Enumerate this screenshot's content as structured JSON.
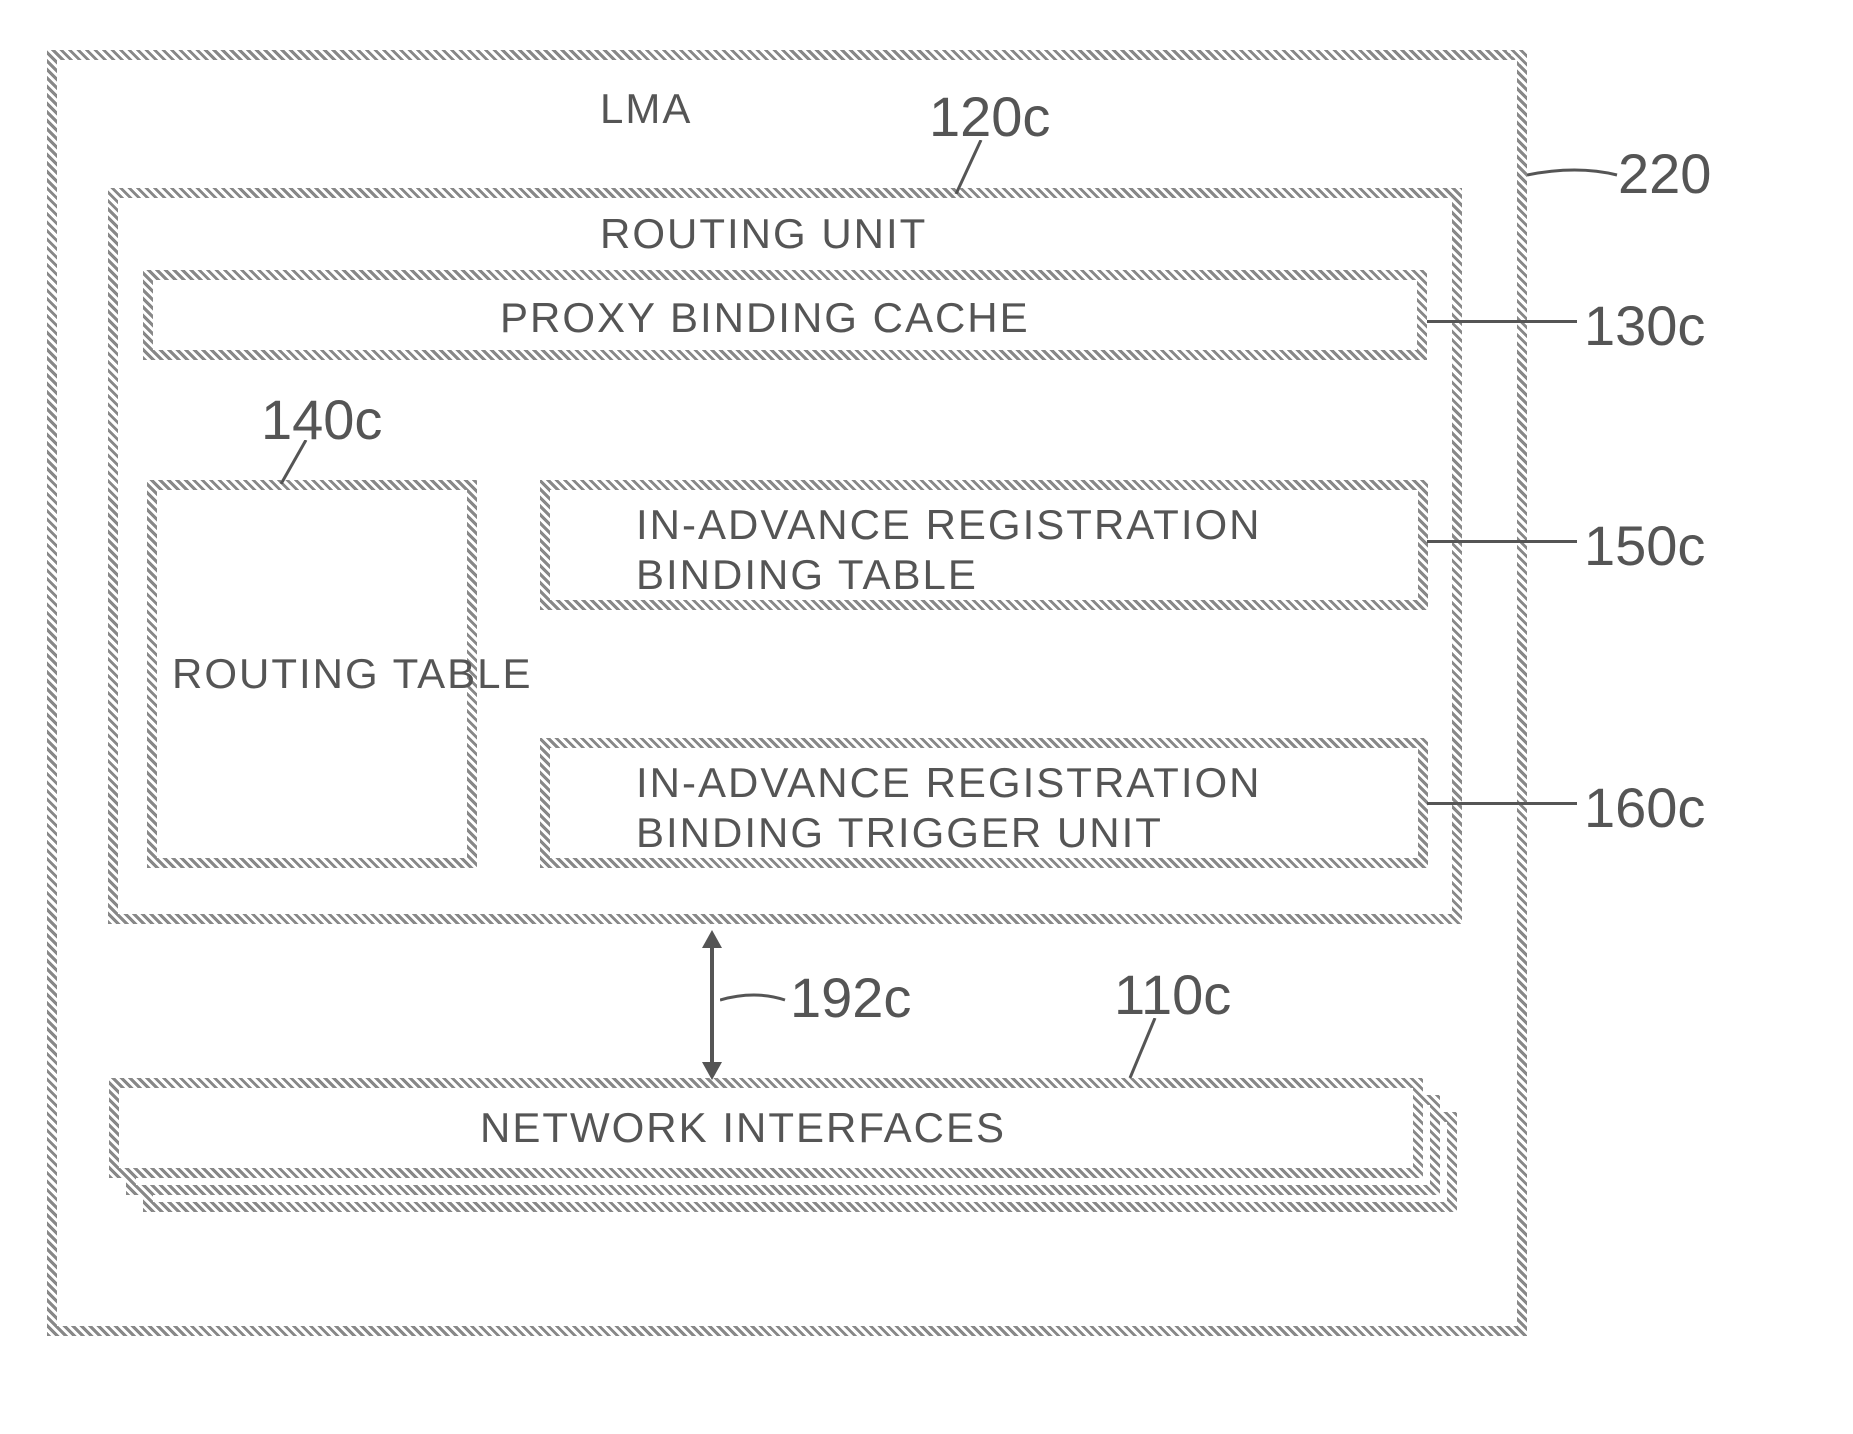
{
  "title": "LMA",
  "labels": {
    "l220": "220",
    "l120c": "120c",
    "l130c": "130c",
    "l140c": "140c",
    "l150c": "150c",
    "l160c": "160c",
    "l192c": "192c",
    "l110c": "110c"
  },
  "blocks": {
    "routing_unit": "ROUTING UNIT",
    "proxy_binding_cache": "PROXY BINDING CACHE",
    "routing_table": "ROUTING TABLE",
    "in_advance_reg_binding_table": "IN-ADVANCE REGISTRATION\nBINDING TABLE",
    "in_advance_reg_binding_trigger": "IN-ADVANCE REGISTRATION\nBINDING TRIGGER UNIT",
    "network_interfaces": "NETWORK INTERFACES"
  }
}
